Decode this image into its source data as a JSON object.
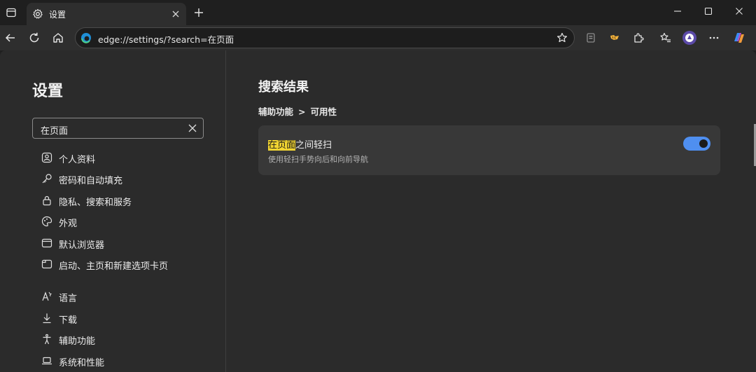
{
  "window": {
    "tab_title": "设置"
  },
  "toolbar": {
    "address_url": "edge://settings/?search=在页面"
  },
  "sidebar": {
    "title": "设置",
    "search_value": "在页面",
    "items": [
      {
        "label": "个人资料",
        "icon": "profile-icon"
      },
      {
        "label": "密码和自动填充",
        "icon": "key-icon"
      },
      {
        "label": "隐私、搜索和服务",
        "icon": "lock-icon"
      },
      {
        "label": "外观",
        "icon": "palette-icon"
      },
      {
        "label": "默认浏览器",
        "icon": "browser-window-icon"
      },
      {
        "label": "启动、主页和新建选项卡页",
        "icon": "home-tabs-icon"
      },
      {
        "label": "语言",
        "icon": "language-icon"
      },
      {
        "label": "下载",
        "icon": "download-icon"
      },
      {
        "label": "辅助功能",
        "icon": "accessibility-icon"
      },
      {
        "label": "系统和性能",
        "icon": "laptop-icon"
      }
    ]
  },
  "main": {
    "heading": "搜索结果",
    "breadcrumb": {
      "section": "辅助功能",
      "separator": ">",
      "subsection": "可用性"
    },
    "result": {
      "title_highlight": "在页面",
      "title_rest": "之间轻扫",
      "description": "使用轻扫手势向后和向前导航",
      "toggle_on": true
    }
  },
  "colors": {
    "accent": "#4f8ff0",
    "highlight": "#f2d531",
    "background": "#2b2b2b",
    "card": "#383838"
  }
}
